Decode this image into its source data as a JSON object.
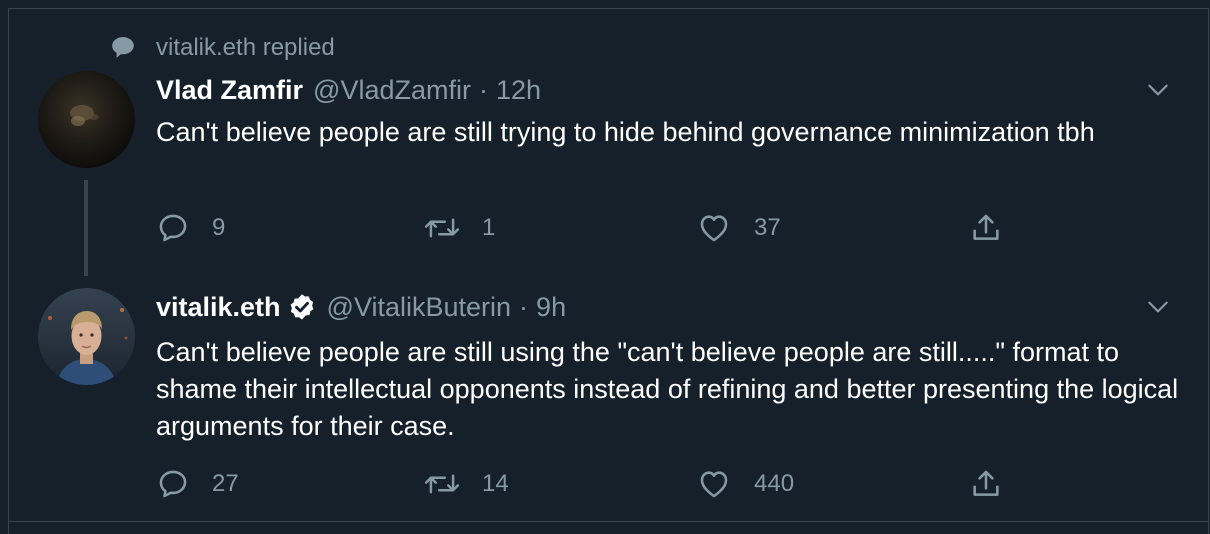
{
  "context": {
    "icon": "speech-bubble-icon",
    "text": "vitalik.eth replied"
  },
  "tweets": [
    {
      "name": "Vlad Zamfir",
      "handle": "@VladZamfir",
      "separator": "·",
      "time": "12h",
      "verified": false,
      "text": "Can't believe people are still trying to hide behind governance minimization tbh",
      "actions": {
        "replies": "9",
        "retweets": "1",
        "likes": "37"
      }
    },
    {
      "name": "vitalik.eth",
      "handle": "@VitalikButerin",
      "separator": "·",
      "time": "9h",
      "verified": true,
      "text": "Can't believe people are still using the \"can't believe people are still.....\" format to shame their intellectual opponents instead of refining and better presenting the logical arguments for their case.",
      "actions": {
        "replies": "27",
        "retweets": "14",
        "likes": "440"
      }
    }
  ],
  "colors": {
    "background": "#15202b",
    "border": "#38444d",
    "secondary_text": "#8899a6",
    "primary_text": "#ffffff"
  }
}
